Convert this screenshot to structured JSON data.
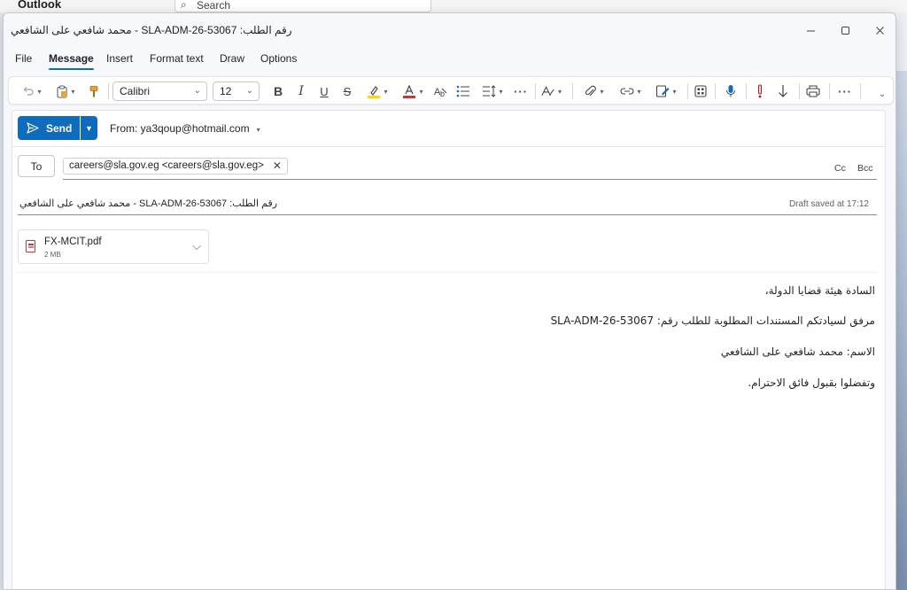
{
  "background": {
    "app_name": "Outlook",
    "search_placeholder": "Search"
  },
  "window": {
    "title": "محمد شافعي على الشافعي - SLA-ADM-26-53067 :رقم الطلب",
    "controls": [
      "minimize",
      "maximize",
      "close"
    ]
  },
  "tabs": [
    {
      "label": "File"
    },
    {
      "label": "Message",
      "active": true
    },
    {
      "label": "Insert"
    },
    {
      "label": "Format text"
    },
    {
      "label": "Draw"
    },
    {
      "label": "Options"
    }
  ],
  "ribbon": {
    "font_name": "Calibri",
    "font_size": "12"
  },
  "compose": {
    "send_label": "Send",
    "from_label": "From: ya3qoup@hotmail.com",
    "to_label": "To",
    "recipient": "careers@sla.gov.eg <careers@sla.gov.eg>",
    "cc_label": "Cc",
    "bcc_label": "Bcc",
    "subject": "محمد شافعي على الشافعي - SLA-ADM-26-53067 :رقم الطلب",
    "draft_status": "Draft saved at 17:12",
    "attachment": {
      "name": "FX-MCIT.pdf",
      "size": "2 MB"
    },
    "body": [
      "السادة هيئة قضايا الدولة،",
      "مرفق لسيادتكم المستندات المطلوبة للطلب رقم: SLA-ADM-26-53067",
      "الاسم: محمد شافعي على الشافعي",
      "وتفضلوا بقبول فائق الاحترام."
    ]
  },
  "colors": {
    "accent": "#0f6cbd",
    "highlight": "#ffd800",
    "font_color": "#d13438"
  }
}
